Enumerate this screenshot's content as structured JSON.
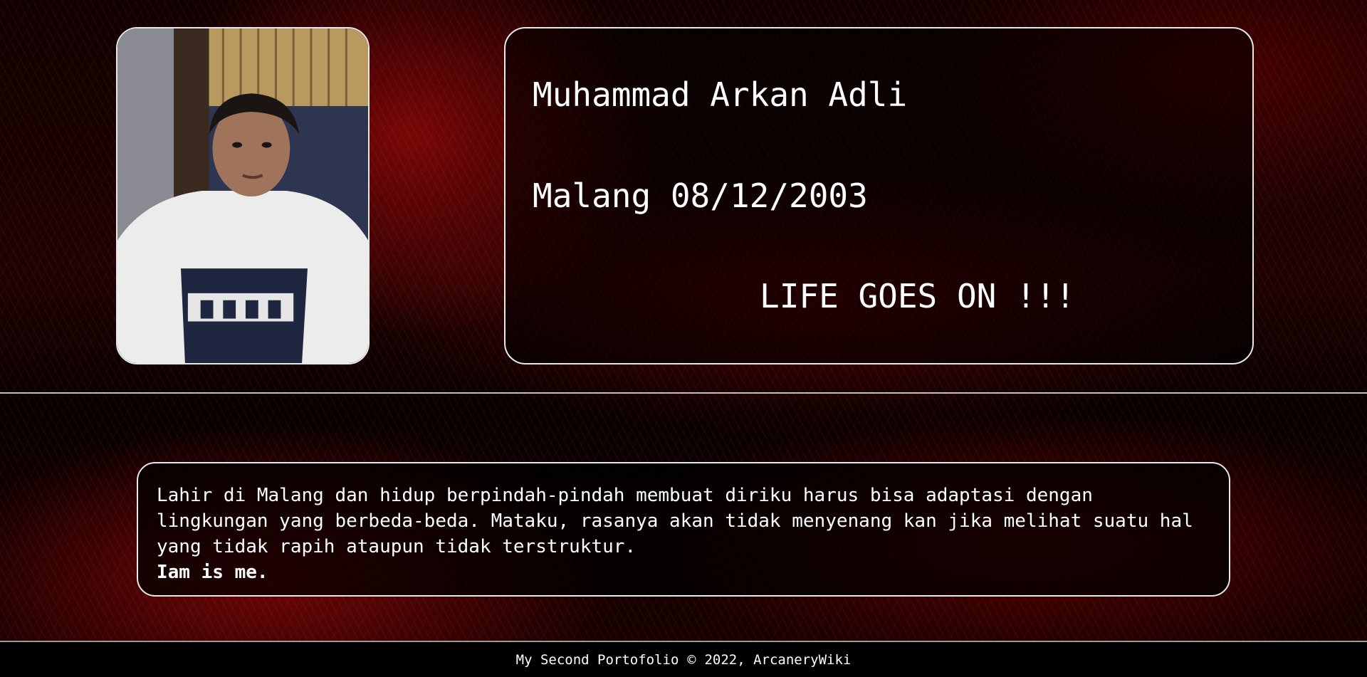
{
  "profile": {
    "name": "Muhammad Arkan Adli",
    "birth": "Malang 08/12/2003",
    "motto": "LIFE GOES ON !!!"
  },
  "bio": {
    "text": "Lahir di Malang dan hidup berpindah-pindah membuat diriku harus bisa adaptasi dengan lingkungan yang berbeda-beda. Mataku, rasanya akan tidak menyenang kan jika melihat suatu hal yang tidak rapih ataupun tidak terstruktur.",
    "closing": "Iam is me."
  },
  "footer": {
    "label": "My Second Portofolio",
    "copyright_symbol": "©",
    "credit": "2022, ArcaneryWiki"
  },
  "colors": {
    "background": "#000000",
    "accent_red": "#b00000",
    "border": "#e8e8e8",
    "text": "#ffffff"
  }
}
